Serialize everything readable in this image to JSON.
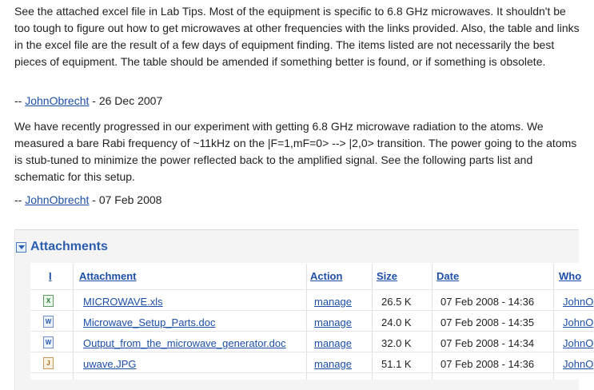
{
  "paragraphs": {
    "p1": "See the attached excel file in Lab Tips. Most of the equipment is specific to 6.8 GHz microwaves. It shouldn't be too tough to figure out how to get microwaves at other frequencies with the links provided. Also, the table and links in the excel file are the result of a few days of equipment finding. The items listed are not necessarily the best pieces of equipment. The table should be amended if something better is found, or if something is obsolete.",
    "p2": "We have recently progressed in our experiment with getting 6.8 GHz microwave radiation to the atoms. We measured a bare Rabi frequency of ~11kHz on the |F=1,mF=0> --> |2,0> transition. The power going to the atoms is stub-tuned to minimize the power reflected back to the amplified signal. See the following parts list and schematic for this setup."
  },
  "signatures": [
    {
      "prefix": "-- ",
      "user": "JohnObrecht",
      "date": " - 26 Dec 2007"
    },
    {
      "prefix": "-- ",
      "user": "JohnObrecht",
      "date": " - 07 Feb 2008"
    }
  ],
  "attachments": {
    "title": "Attachments",
    "headers": {
      "icon": "I",
      "attachment": "Attachment",
      "action": "Action",
      "size": "Size",
      "date": "Date",
      "who": "Who"
    },
    "rows": [
      {
        "icon": "xls",
        "name": "MICROWAVE.xls",
        "action": "manage",
        "size": "26.5 K",
        "date": "07 Feb 2008 - 14:36",
        "who": "JohnO"
      },
      {
        "icon": "doc",
        "name": "Microwave_Setup_Parts.doc",
        "action": "manage",
        "size": "24.0 K",
        "date": "07 Feb 2008 - 14:35",
        "who": "JohnO"
      },
      {
        "icon": "doc",
        "name": "Output_from_the_microwave_generator.doc",
        "action": "manage",
        "size": "32.0 K",
        "date": "07 Feb 2008 - 14:34",
        "who": "JohnO"
      },
      {
        "icon": "jpg",
        "name": "uwave.JPG",
        "action": "manage",
        "size": "51.1 K",
        "date": "07 Feb 2008 - 14:36",
        "who": "JohnO"
      }
    ]
  }
}
